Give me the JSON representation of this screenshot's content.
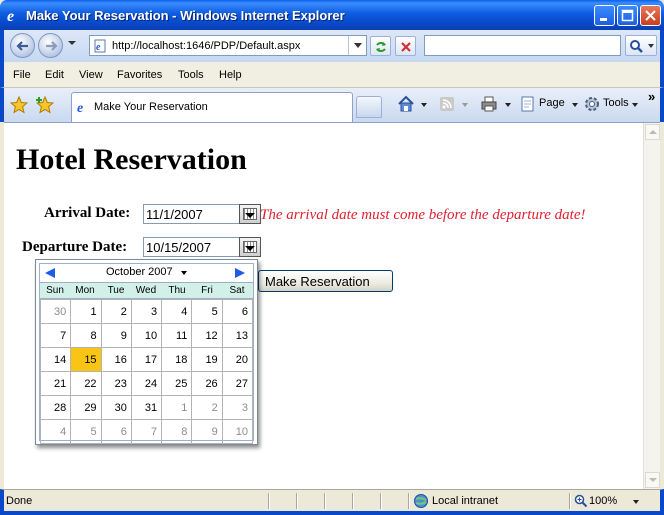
{
  "window": {
    "title": "Make Your Reservation - Windows Internet Explorer"
  },
  "addressbar": {
    "url": "http://localhost:1646/PDP/Default.aspx",
    "search_value": ""
  },
  "menu": {
    "items": [
      "File",
      "Edit",
      "View",
      "Favorites",
      "Tools",
      "Help"
    ]
  },
  "tab": {
    "label": "Make Your Reservation"
  },
  "commands": {
    "page": "Page",
    "tools": "Tools",
    "more": "»"
  },
  "page": {
    "heading": "Hotel Reservation",
    "arrival_label": "Arrival Date:",
    "arrival_value": "11/1/2007",
    "departure_label": "Departure Date:",
    "departure_value": "10/15/2007",
    "error_message": "The arrival date must come before the departure date!",
    "submit_label": "Make Reservation"
  },
  "calendar": {
    "month": "October 2007",
    "days_of_week": [
      "Sun",
      "Mon",
      "Tue",
      "Wed",
      "Thu",
      "Fri",
      "Sat"
    ],
    "selected_day": "15",
    "weeks": [
      [
        {
          "d": "30",
          "o": true
        },
        {
          "d": "1"
        },
        {
          "d": "2"
        },
        {
          "d": "3"
        },
        {
          "d": "4"
        },
        {
          "d": "5"
        },
        {
          "d": "6"
        }
      ],
      [
        {
          "d": "7"
        },
        {
          "d": "8"
        },
        {
          "d": "9"
        },
        {
          "d": "10"
        },
        {
          "d": "11"
        },
        {
          "d": "12"
        },
        {
          "d": "13"
        }
      ],
      [
        {
          "d": "14"
        },
        {
          "d": "15",
          "s": true
        },
        {
          "d": "16"
        },
        {
          "d": "17"
        },
        {
          "d": "18"
        },
        {
          "d": "19"
        },
        {
          "d": "20"
        }
      ],
      [
        {
          "d": "21"
        },
        {
          "d": "22"
        },
        {
          "d": "23"
        },
        {
          "d": "24"
        },
        {
          "d": "25"
        },
        {
          "d": "26"
        },
        {
          "d": "27"
        }
      ],
      [
        {
          "d": "28"
        },
        {
          "d": "29"
        },
        {
          "d": "30"
        },
        {
          "d": "31"
        },
        {
          "d": "1",
          "o": true
        },
        {
          "d": "2",
          "o": true
        },
        {
          "d": "3",
          "o": true
        }
      ],
      [
        {
          "d": "4",
          "o": true
        },
        {
          "d": "5",
          "o": true
        },
        {
          "d": "6",
          "o": true
        },
        {
          "d": "7",
          "o": true
        },
        {
          "d": "8",
          "o": true
        },
        {
          "d": "9",
          "o": true
        },
        {
          "d": "10",
          "o": true
        }
      ]
    ]
  },
  "statusbar": {
    "status": "Done",
    "zone": "Local intranet",
    "zoom": "100%"
  },
  "colors": {
    "error": "#E02030",
    "selected_day": "#F9C514",
    "dow_header": "#D2F0E8",
    "titlebar": "#0848C9"
  }
}
